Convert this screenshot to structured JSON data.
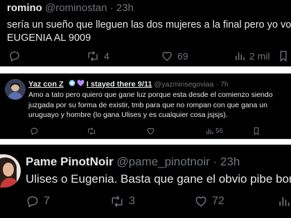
{
  "tweets": [
    {
      "name": "romino",
      "handle": "@rominostan",
      "separator": "·",
      "time": "23h",
      "text_line1": "sería un sueño que lleguen las dos mujeres a la final pero yo voy",
      "text_line2": "EUGENIA AL 9009",
      "retweets": "4",
      "likes": "69",
      "views": "2 mil",
      "icons": [
        "reply-icon",
        "retweet-icon",
        "like-icon",
        "views-icon",
        "bookmark-icon"
      ]
    },
    {
      "name_prefix": "Yaz con Z",
      "name_suffix": "I stayed there 9/11",
      "handle": "@yazminsegoviaa",
      "separator": "·",
      "time": "7h",
      "text_line1": "Amo a tato pero quiero que gane luz porque esta desde el comienzo siendo",
      "text_line2": "juzgada por su forma de existir, tmb para que no rompan con que gana un",
      "text_line3": "uruguayo y hombre (lo gana Ulises y es cualquier cosa jsjsjs).",
      "views": "56",
      "heart_colors": [
        "#7ec8f0",
        "#b28bff"
      ],
      "icons": [
        "reply-icon",
        "retweet-icon",
        "like-icon",
        "views-icon",
        "bookmark-icon"
      ]
    },
    {
      "name": "Pame PinotNoir",
      "handle": "@pame_pinotnoir",
      "separator": "·",
      "time": "23h",
      "text_line1": "Ulises o Eugenia. Basta que gane el obvio pibe bonito",
      "replies": "7",
      "retweets": "3",
      "likes": "72",
      "icons": [
        "reply-icon",
        "retweet-icon",
        "like-icon",
        "views-icon"
      ]
    }
  ],
  "colors": {
    "background": "#000000",
    "text": "#e7e9ea",
    "muted": "#71767b",
    "divider": "#ffffff"
  }
}
